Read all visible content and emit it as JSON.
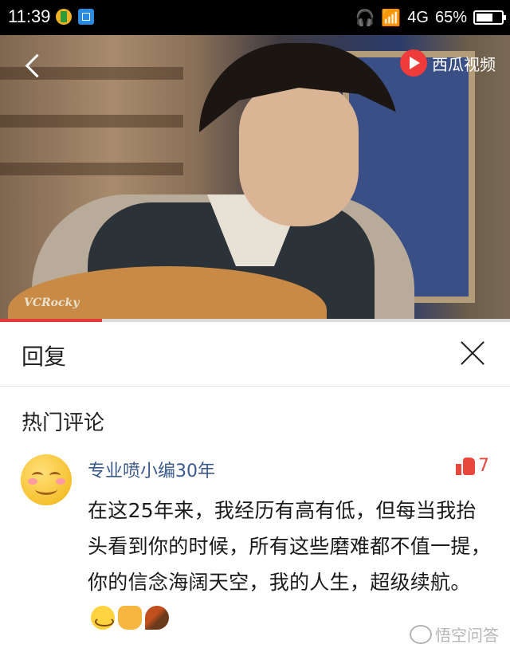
{
  "status_bar": {
    "time": "11:39",
    "network": "4G",
    "battery": "65%"
  },
  "video": {
    "watermark": "VCRocky",
    "brand": "西瓜视频",
    "progress": 0.2
  },
  "reply": {
    "title": "回复"
  },
  "comments_section": {
    "title": "热门评论",
    "items": [
      {
        "username": "专业喷小编30年",
        "likes": "7",
        "text": "在这25年来，我经历有高有低，但每当我抬头看到你的时候，所有这些磨难都不值一提，你的信念海阔天空，我的人生，超级续航。"
      }
    ]
  },
  "footer": {
    "watermark": "悟空问答"
  }
}
